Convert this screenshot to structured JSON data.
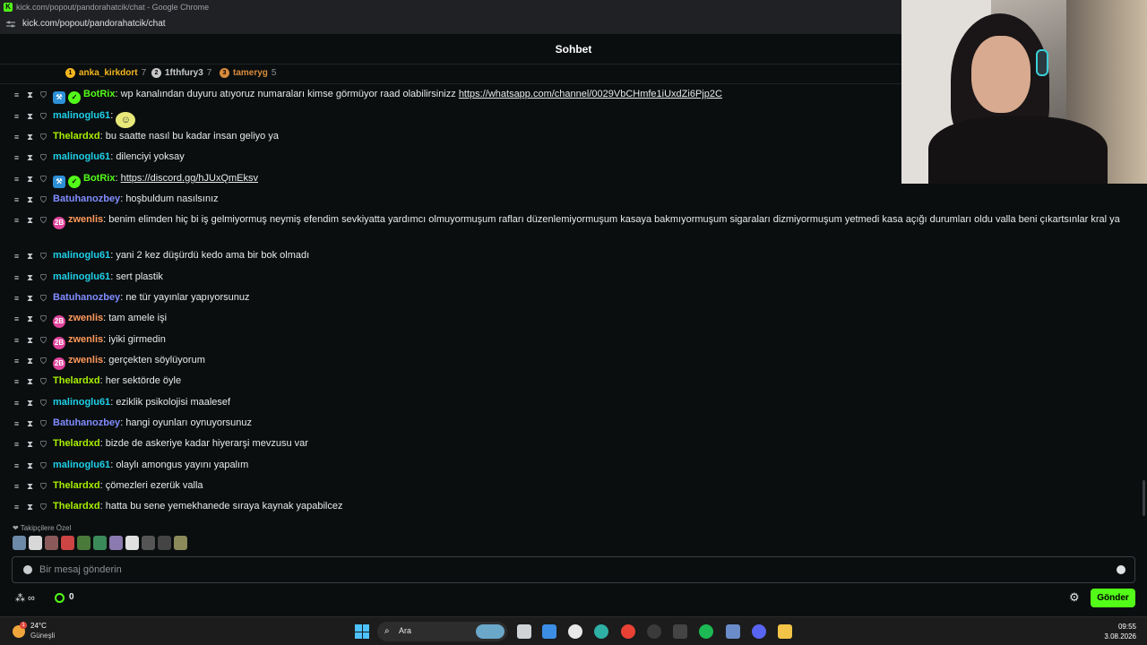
{
  "browser": {
    "title": "kick.com/popout/pandorahatcik/chat - Google Chrome",
    "url": "kick.com/popout/pandorahatcik/chat"
  },
  "chat": {
    "title": "Sohbet",
    "pinned_gifters": [
      {
        "rank": "1",
        "name": "anka_kirkdort",
        "count": "7",
        "color": "#f3b71e"
      },
      {
        "rank": "2",
        "name": "1fthfury3",
        "count": "7",
        "color": "#c8c8c8"
      },
      {
        "rank": "3",
        "name": "tameryg",
        "count": "5",
        "color": "#d98b3c"
      }
    ],
    "messages": [
      {
        "user": "BotRix",
        "color": "#53fc18",
        "bot": true,
        "text": "wp kanalından duyuru atıyoruz numaraları kimse görmüyor raad olabilirsinizz",
        "link": "https://whatsapp.com/channel/0029VbCHmfe1iUxdZi6Pjp2C"
      },
      {
        "user": "malinoglu61",
        "color": "#1ed0e8",
        "text": "",
        "emote": true
      },
      {
        "user": "Thelardxd",
        "color": "#a8f000",
        "text": "bu saatte nasıl bu kadar insan geliyo ya"
      },
      {
        "user": "malinoglu61",
        "color": "#1ed0e8",
        "text": "dilenciyi yoksay"
      },
      {
        "user": "BotRix",
        "color": "#53fc18",
        "bot": true,
        "text": "",
        "link": "https://discord.gg/hJUxQmEksv"
      },
      {
        "user": "Batuhanozbey",
        "color": "#7f8cff",
        "text": "hoşbuldum nasılsınız"
      },
      {
        "user": "zwenlis",
        "color": "#ff9a5c",
        "sub": true,
        "text": "benim elimden hiç bi iş gelmiyormuş neymiş efendim sevkiyatta yardımcı olmuyormuşum rafları düzenlemiyormuşum kasaya bakmıyormuşum sigaraları dizmiyormuşum yetmedi kasa açığı durumları oldu valla beni çıkartsınlar kral ya"
      },
      {
        "user": "malinoglu61",
        "color": "#1ed0e8",
        "text": "yani 2 kez düşürdü kedo ama bir bok olmadı"
      },
      {
        "user": "malinoglu61",
        "color": "#1ed0e8",
        "text": "sert plastik"
      },
      {
        "user": "Batuhanozbey",
        "color": "#7f8cff",
        "text": "ne tür yayınlar yapıyorsunuz"
      },
      {
        "user": "zwenlis",
        "color": "#ff9a5c",
        "sub": true,
        "text": "tam amele işi"
      },
      {
        "user": "zwenlis",
        "color": "#ff9a5c",
        "sub": true,
        "text": "iyiki girmedin"
      },
      {
        "user": "zwenlis",
        "color": "#ff9a5c",
        "sub": true,
        "text": "gerçekten söylüyorum"
      },
      {
        "user": "Thelardxd",
        "color": "#a8f000",
        "text": "her sektörde öyle"
      },
      {
        "user": "malinoglu61",
        "color": "#1ed0e8",
        "text": "eziklik psikolojisi maalesef"
      },
      {
        "user": "Batuhanozbey",
        "color": "#7f8cff",
        "text": "hangi oyunları oynuyorsunuz"
      },
      {
        "user": "Thelardxd",
        "color": "#a8f000",
        "text": "bizde de askeriye kadar hiyerarşi mevzusu var"
      },
      {
        "user": "malinoglu61",
        "color": "#1ed0e8",
        "text": "olaylı amongus yayını yapalım"
      },
      {
        "user": "Thelardxd",
        "color": "#a8f000",
        "text": "çömezleri ezerük valla"
      },
      {
        "user": "Thelardxd",
        "color": "#a8f000",
        "text": "hatta bu sene yemekhanede sıraya kaynak yapabilcez"
      }
    ],
    "followers_label": "Takipçilere Özel",
    "input_placeholder": "Bir mesaj gönderin",
    "points": "0",
    "send_label": "Gönder"
  },
  "taskbar": {
    "temp": "24°C",
    "weather": "Güneşli",
    "weather_badge": "1",
    "search_label": "Ara",
    "time": "09:55",
    "date": "3.08.2026"
  }
}
